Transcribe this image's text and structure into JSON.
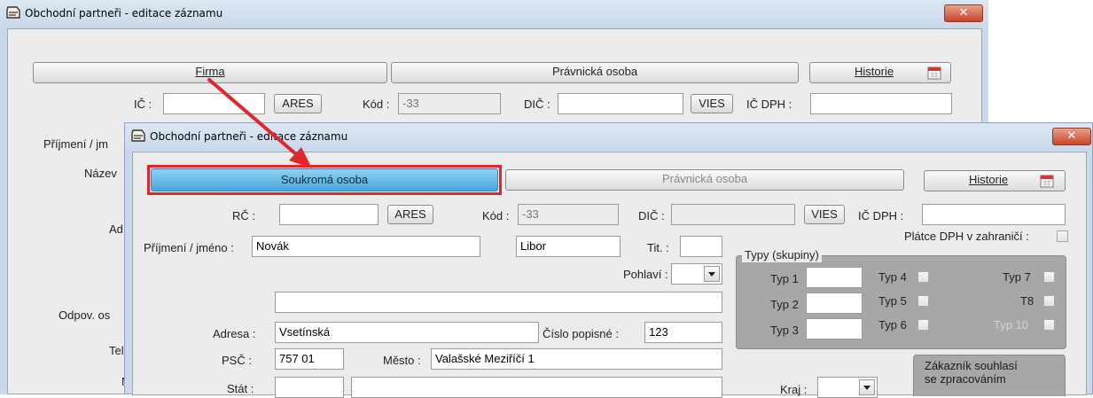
{
  "back_window": {
    "title": "Obchodní partneři - editace záznamu",
    "close_label": "✕",
    "tabs": {
      "firma": "Firma",
      "pravnicka": "Právnická osoba"
    },
    "historie_label": "Historie",
    "fields": {
      "ic_label": "IČ :",
      "ares_label": "ARES",
      "kod_label": "Kód :",
      "kod_value": "-33",
      "dic_label": "DIČ :",
      "vies_label": "VIES",
      "ic_dph_label": "IČ DPH :"
    },
    "left_labels": [
      "Příjmení / jm",
      "Název",
      "Ad",
      "Odpov. os",
      "Tel",
      "N"
    ]
  },
  "front_window": {
    "title": "Obchodní partneři - editace záznamu",
    "close_label": "✕",
    "tabs": {
      "soukroma": "Soukromá osoba",
      "pravnicka": "Právnická osoba"
    },
    "historie_label": "Historie",
    "rc_label": "RČ :",
    "ares_label": "ARES",
    "kod_label": "Kód :",
    "kod_value": "-33",
    "dic_label": "DIČ :",
    "vies_label": "VIES",
    "ic_dph_label": "IČ DPH :",
    "prijmeni_label": "Příjmení / jméno :",
    "prijmeni_value": "Novák",
    "jmeno_value": "Libor",
    "tit_label": "Tit. :",
    "pohlavi_label": "Pohlaví :",
    "adresa_label": "Adresa :",
    "adresa_value": "Vsetínská",
    "cislo_popisne_label": "Číslo popisné :",
    "cislo_popisne_value": "123",
    "psc_label": "PSČ :",
    "psc_value": "757 01",
    "mesto_label": "Město :",
    "mesto_value": "Valašské Meziříčí 1",
    "stat_label": "Stát :",
    "kraj_label": "Kraj :",
    "platce_dph_label": "Plátce DPH v zahraničí :",
    "typy": {
      "legend": "Typy (skupiny)",
      "typ1": "Typ 1",
      "typ2": "Typ 2",
      "typ3": "Typ 3",
      "typ4": "Typ 4",
      "typ5": "Typ 5",
      "typ6": "Typ 6",
      "typ7": "Typ 7",
      "t8": "T8",
      "typ10": "Typ 10"
    },
    "zakaznik_text": "Zákazník souhlasí se zpracováním"
  },
  "colors": {
    "annotation": "#e0262e",
    "active_tab": "#46a9dd"
  }
}
